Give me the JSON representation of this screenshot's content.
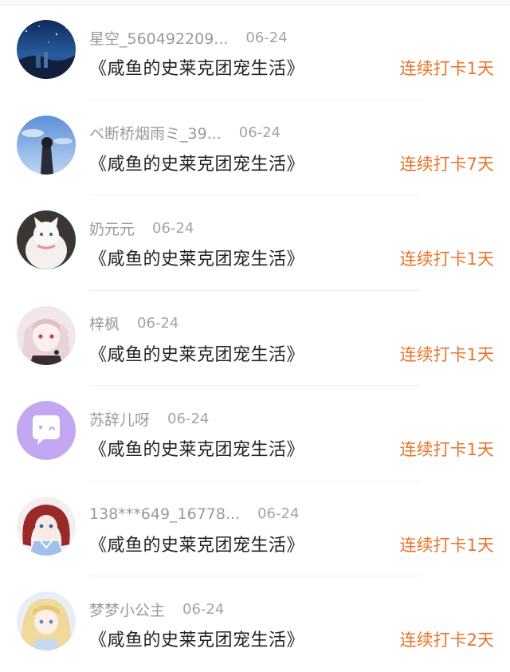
{
  "checkins": [
    {
      "username": "星空_560492209...",
      "date": "06-24",
      "book_title": "《咸鱼的史莱克团宠生活》",
      "streak": "连续打卡1天",
      "avatar_icon": "starry-sky-avatar-icon"
    },
    {
      "username": "ベ断桥烟雨ミ_39...",
      "date": "06-24",
      "book_title": "《咸鱼的史莱克团宠生活》",
      "streak": "连续打卡7天",
      "avatar_icon": "girl-sky-avatar-icon"
    },
    {
      "username": "奶元元",
      "date": "06-24",
      "book_title": "《咸鱼的史莱克团宠生活》",
      "streak": "连续打卡1天",
      "avatar_icon": "white-cat-avatar-icon"
    },
    {
      "username": "梓枫",
      "date": "06-24",
      "book_title": "《咸鱼的史莱克团宠生活》",
      "streak": "连续打卡1天",
      "avatar_icon": "anime-girl-pink-avatar-icon"
    },
    {
      "username": "苏辞儿呀",
      "date": "06-24",
      "book_title": "《咸鱼的史莱克团宠生活》",
      "streak": "连续打卡1天",
      "avatar_icon": "chat-bubble-avatar-icon"
    },
    {
      "username": "138***649_16778...",
      "date": "06-24",
      "book_title": "《咸鱼的史莱克团宠生活》",
      "streak": "连续打卡1天",
      "avatar_icon": "anime-girl-red-hair-avatar-icon"
    },
    {
      "username": "梦梦小公主",
      "date": "06-24",
      "book_title": "《咸鱼的史莱克团宠生活》",
      "streak": "连续打卡2天",
      "avatar_icon": "anime-girl-blonde-avatar-icon"
    }
  ],
  "colors": {
    "streak": "#e8742c",
    "username": "#9a9a9a",
    "title": "#222222",
    "divider": "#efefef"
  }
}
